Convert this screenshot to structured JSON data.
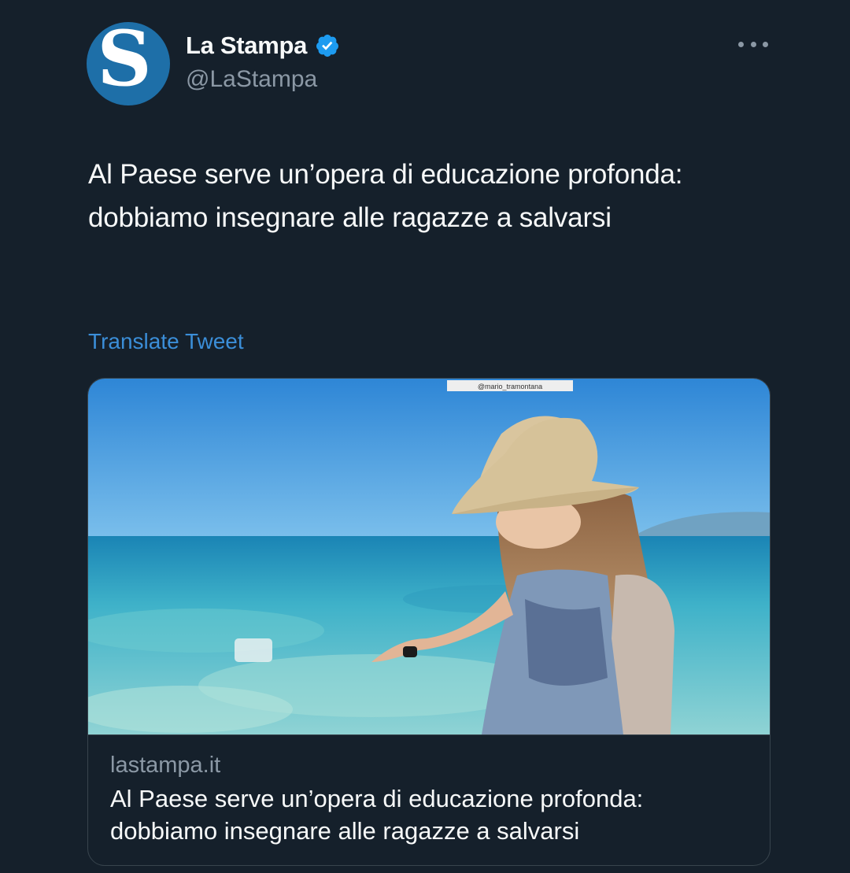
{
  "account": {
    "name": "La Stampa",
    "handle": "@LaStampa",
    "avatar_letter": "S",
    "verified": true
  },
  "tweet": {
    "text": "Al Paese serve un’opera di educazione profonda: dobbiamo insegnare alle ragazze a salvarsi",
    "translate_label": "Translate Tweet"
  },
  "link_card": {
    "domain": "lastampa.it",
    "title": "Al Paese serve un’opera di educazione profonda: dobbiamo insegnare alle ragazze a salvarsi",
    "image_watermark": "@mario_tramontana"
  },
  "icons": {
    "verified": "verified-badge-icon",
    "more": "more-options-icon"
  },
  "colors": {
    "background": "#15202b",
    "accent": "#1d9bf0",
    "link": "#3b8ed8",
    "secondary_text": "#8b98a5"
  }
}
